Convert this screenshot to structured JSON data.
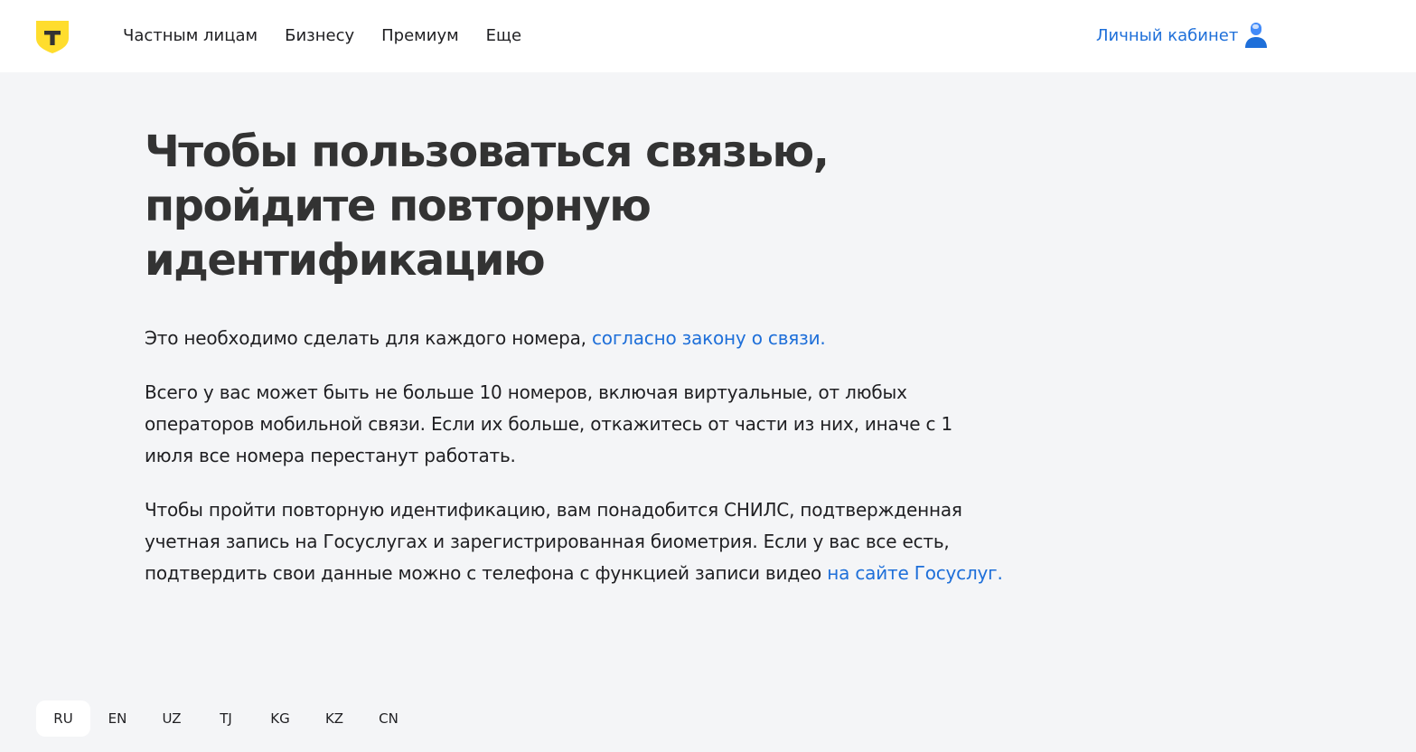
{
  "header": {
    "nav": [
      "Частным лицам",
      "Бизнесу",
      "Премиум",
      "Еще"
    ],
    "cabinet_label": "Личный кабинет",
    "logo_letter": "Т",
    "logo_color": "#ffdd2d",
    "link_color": "#1e6fd9"
  },
  "main": {
    "title": "Чтобы пользоваться связью, пройдите повторную идентификацию",
    "p1_text": "Это необходимо сделать для каждого номера, ",
    "p1_link": "согласно закону о связи.",
    "p2_text": "Всего у вас может быть не больше 10 номеров, включая виртуальные, от любых операторов мобильной связи. Если их больше, откажитесь от части из них, иначе с 1 июля все номера перестанут работать.",
    "p3_text": "Чтобы пройти повторную идентификацию, вам понадобится СНИЛС, подтвержденная учетная запись на Госуслугах и зарегистрированная биометрия. Если у вас все есть, подтвердить свои данные можно с телефона с функцией записи видео ",
    "p3_link": "на сайте Госуслуг."
  },
  "languages": {
    "items": [
      "RU",
      "EN",
      "UZ",
      "TJ",
      "KG",
      "KZ",
      "CN"
    ],
    "selected": "RU"
  }
}
